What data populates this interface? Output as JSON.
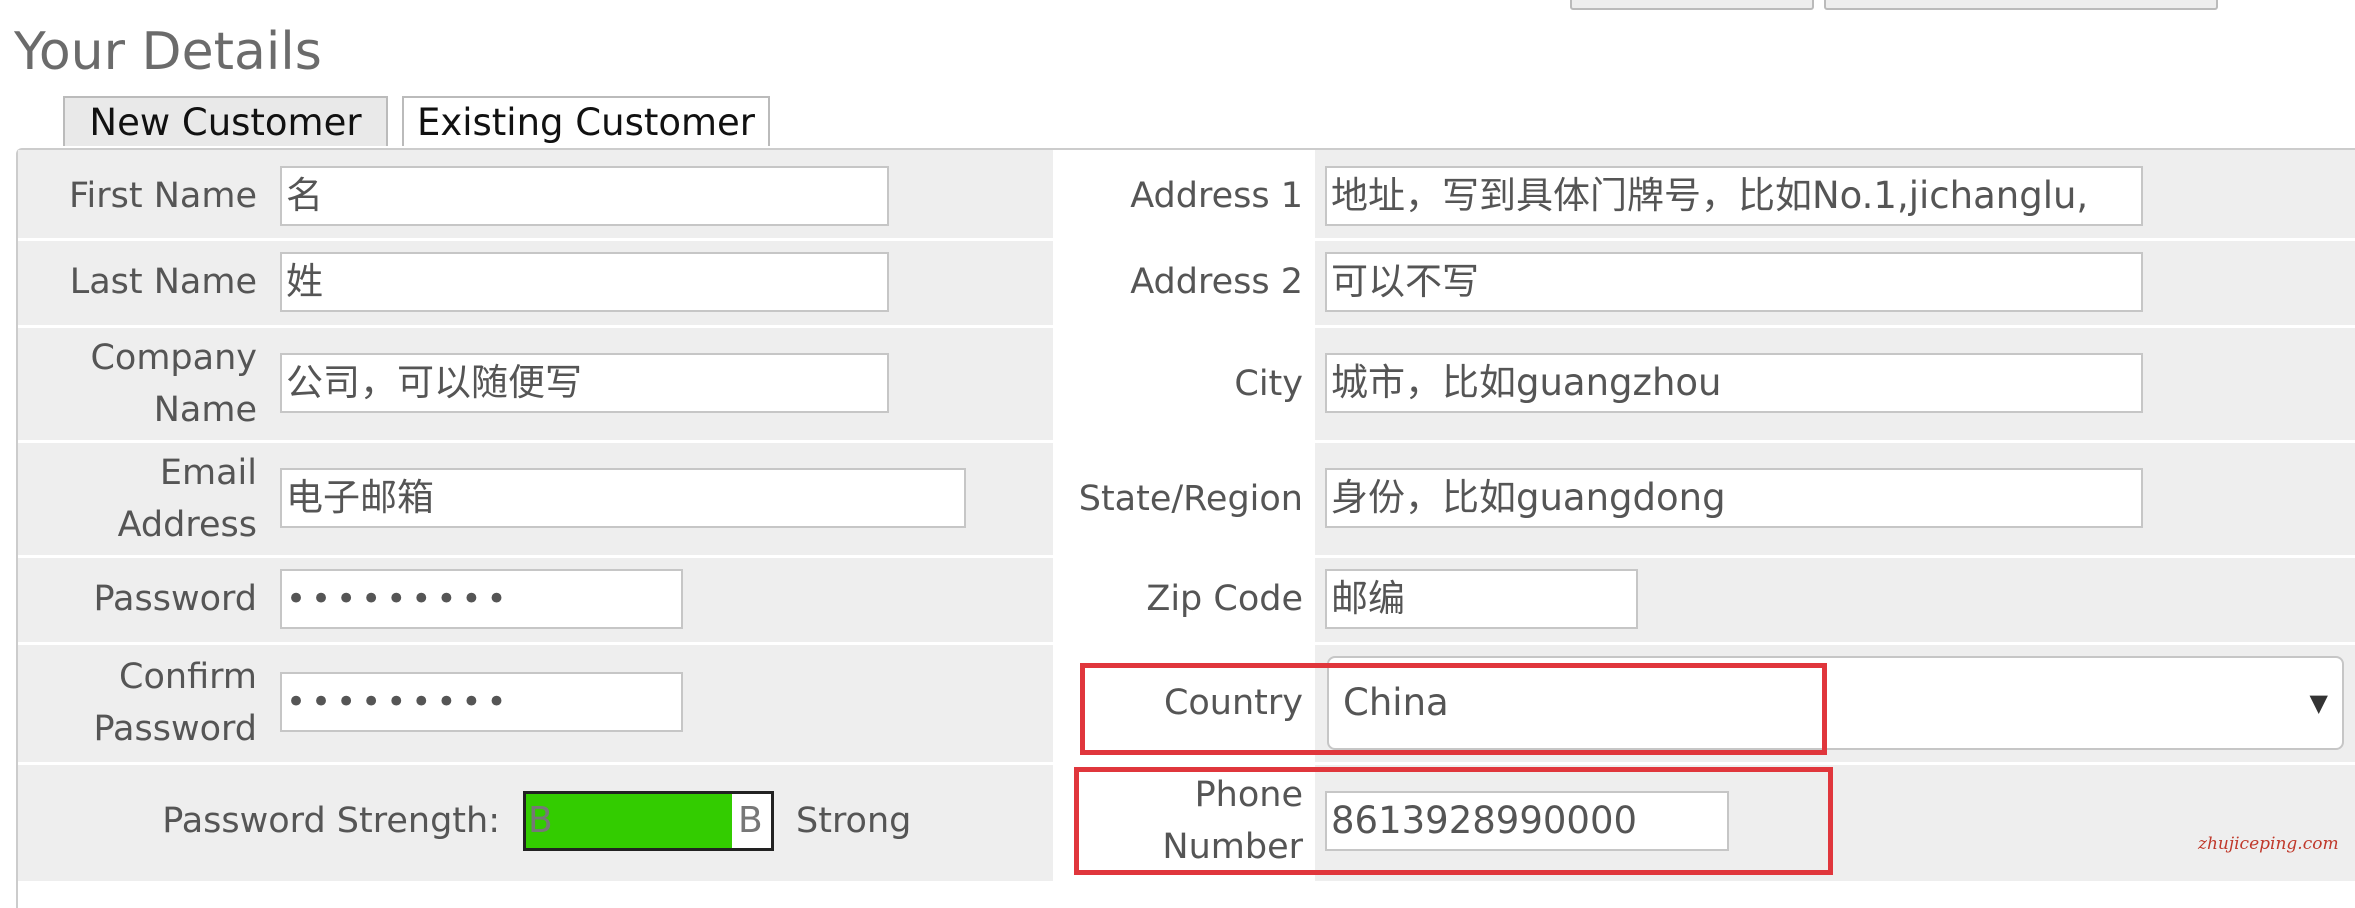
{
  "page": {
    "title": "Your Details"
  },
  "tabs": [
    {
      "label": "New Customer",
      "active": true
    },
    {
      "label": "Existing Customer",
      "active": false
    }
  ],
  "form_left": {
    "first_name": {
      "label": "First Name",
      "value": "名"
    },
    "last_name": {
      "label": "Last Name",
      "value": "姓"
    },
    "company_name": {
      "label_line1": "Company",
      "label_line2": "Name",
      "value": "公司，可以随便写"
    },
    "email": {
      "label_line1": "Email",
      "label_line2": "Address",
      "value": "电子邮箱"
    },
    "password": {
      "label": "Password",
      "value": "•••••••••"
    },
    "confirm_password": {
      "label_line1": "Confirm",
      "label_line2": "Password",
      "value": "•••••••••"
    }
  },
  "form_right": {
    "address1": {
      "label": "Address 1",
      "value": "地址，写到具体门牌号，比如No.1,jichanglu,"
    },
    "address2": {
      "label": "Address 2",
      "value": "可以不写"
    },
    "city": {
      "label": "City",
      "value": "城市，比如guangzhou"
    },
    "state": {
      "label": "State/Region",
      "value": "身份，比如guangdong"
    },
    "zip": {
      "label": "Zip Code",
      "value": "邮编"
    },
    "country": {
      "label": "Country",
      "value": "China",
      "arrow": "▼"
    },
    "phone": {
      "label_line1": "Phone",
      "label_line2": "Number",
      "value": "8613928990000"
    }
  },
  "password_strength": {
    "label": "Password Strength:",
    "marker_left": "B",
    "marker_right": "B",
    "fill_fraction": 0.84,
    "text": "Strong",
    "fill_color": "#33cc00"
  },
  "highlight_color": "#e0363c",
  "watermark": "zhujiceping.com"
}
